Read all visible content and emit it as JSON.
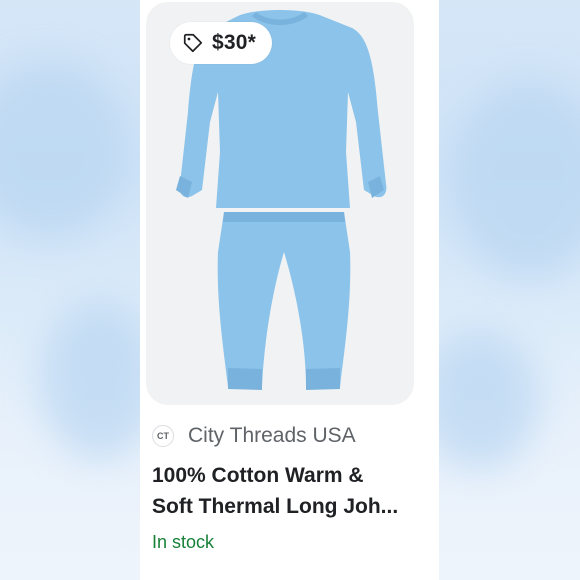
{
  "product": {
    "price": "$30*",
    "icons": {
      "price_tag": "price-tag-icon",
      "seller_logo": "seller-logo-icon"
    },
    "image_subject": "light blue thermal long john set",
    "seller": {
      "logo_text": "CT",
      "name": "City Threads USA"
    },
    "title_line_1": "100% Cotton Warm &",
    "title_line_2": "Soft Thermal Long Joh...",
    "stock_status": "In stock"
  },
  "colors": {
    "garment": "#8cc3ea",
    "garment_shade": "#78b2dd",
    "stock_green": "#188038",
    "image_bg": "#f1f2f3"
  }
}
